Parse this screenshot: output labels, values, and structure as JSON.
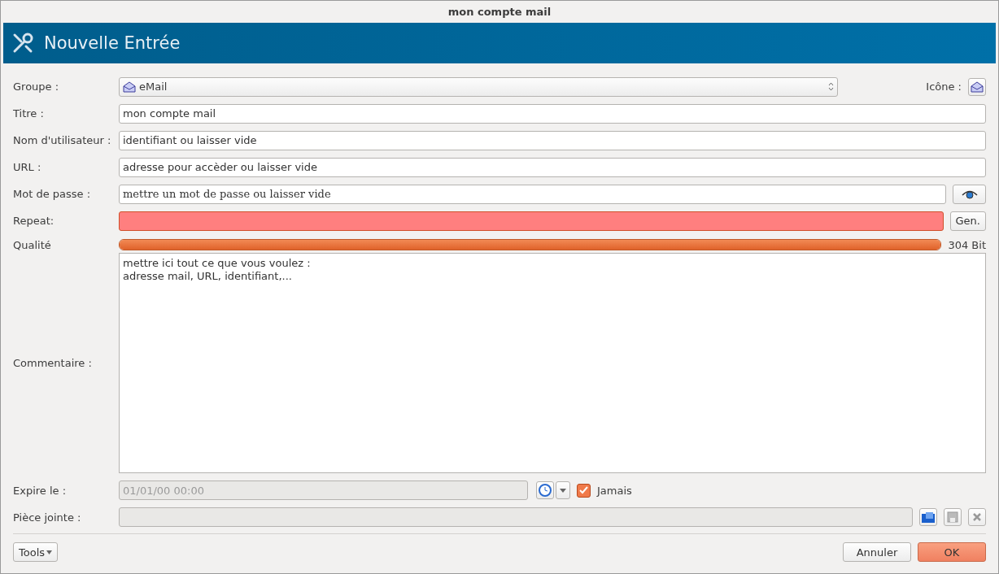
{
  "window": {
    "title": "mon compte mail"
  },
  "header": {
    "title": "Nouvelle Entrée"
  },
  "group": {
    "label": "Groupe :",
    "value": "eMail"
  },
  "icon": {
    "label": "Icône :"
  },
  "fields": [
    {
      "label": "Titre :",
      "value": "mon compte mail"
    },
    {
      "label": "Nom d'utilisateur :",
      "value": "identifiant ou laisser vide"
    },
    {
      "label": "URL :",
      "value": "adresse pour accèder ou laisser vide"
    }
  ],
  "password": {
    "label": "Mot de passe :",
    "value": "mettre un mot de passe ou laisser vide"
  },
  "repeat": {
    "label": "Repeat:",
    "invalid": true,
    "button": "Gen."
  },
  "quality": {
    "label": "Qualité",
    "level": 1,
    "reading": "304 Bit"
  },
  "comment": {
    "label": "Commentaire :",
    "value": "mettre ici tout ce que vous voulez :\nadresse mail, URL, identifiant,..."
  },
  "expires": {
    "label": "Expire le :",
    "value": "01/01/00 00:00",
    "disabled": true,
    "never_label": "Jamais",
    "never": true
  },
  "attachment": {
    "label": "Pièce jointe :"
  },
  "buttons": {
    "tools": "Tools",
    "cancel": "Annuler",
    "ok": "OK"
  }
}
